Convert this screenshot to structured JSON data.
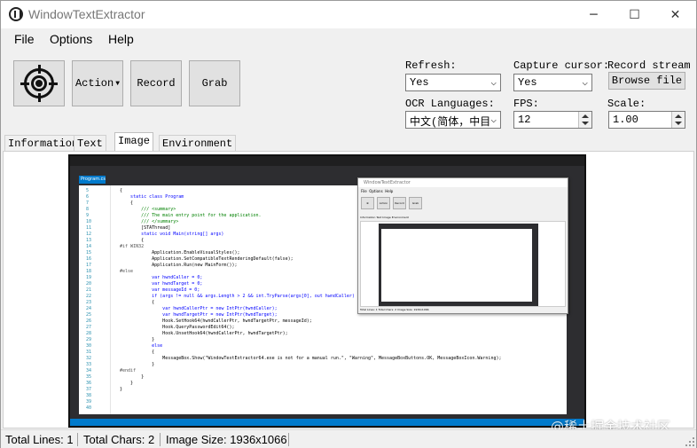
{
  "window": {
    "title": "WindowTextExtractor",
    "minimize": "─",
    "maximize": "☐",
    "close": "✕"
  },
  "menu": {
    "file": "File",
    "options": "Options",
    "help": "Help"
  },
  "toolbar": {
    "action_label": "Action",
    "record_label": "Record",
    "grab_label": "Grab"
  },
  "settings": {
    "refresh_label": "Refresh:",
    "refresh_value": "Yes",
    "capture_cursor_label": "Capture cursor:",
    "capture_cursor_value": "Yes",
    "record_stream_label": "Record stream to:",
    "browse_label": "Browse file",
    "ocr_label": "OCR Languages:",
    "ocr_value": "中文(简体，中目",
    "fps_label": "FPS:",
    "fps_value": "12",
    "scale_label": "Scale:",
    "scale_value": "1.00"
  },
  "tabs": [
    "Information",
    "Text",
    "Image",
    "Environment"
  ],
  "active_tab": "Image",
  "status": {
    "total_lines": "Total Lines: 1",
    "total_chars": "Total Chars: 2",
    "image_size": "Image Size: 1936x1066"
  },
  "watermark": "@稀土掘金技术社区",
  "screenshot": {
    "editor_tab": "Program.cs",
    "nested_title": "WindowTextExtractor",
    "nested_status": "Total Lines: 1   Total Chars: 2   Image Size: 1936x1066",
    "line_numbers": [
      "5",
      "6",
      "7",
      "8",
      "9",
      "10",
      "11",
      "12",
      "13",
      "14",
      "15",
      "16",
      "17",
      "18",
      "19",
      "20",
      "21",
      "22",
      "23",
      "24",
      "25",
      "26",
      "27",
      "28",
      "29",
      "30",
      "31",
      "32",
      "33",
      "34",
      "35",
      "36",
      "37",
      "38",
      "39",
      "40"
    ],
    "code": [
      "  {",
      "      static class Program",
      "      {",
      "          /// <summary>",
      "          /// The main entry point for the application.",
      "          /// </summary>",
      "          [STAThread]",
      "          static void Main(string[] args)",
      "          {",
      "  #if WIN32",
      "              Application.EnableVisualStyles();",
      "              Application.SetCompatibleTextRenderingDefault(false);",
      "              Application.Run(new MainForm());",
      "  #else",
      "              var hwndCaller = 0;",
      "              var hwndTarget = 0;",
      "              var messageId = 0;",
      "              if (args != null && args.Length > 2 && int.TryParse(args[0], out hwndCaller) &&",
      "              {",
      "                  var hwndCallerPtr = new IntPtr(hwndCaller);",
      "                  var hwndTargetPtr = new IntPtr(hwndTarget);",
      "                  Hook.SetHook64(hwndCallerPtr, hwndTargetPtr, messageId);",
      "                  Hook.QueryPasswordEdit64();",
      "                  Hook.UnsetHook64(hwndCallerPtr, hwndTargetPtr);",
      "              }",
      "              else",
      "              {",
      "                  MessageBox.Show(\"WindowTextExtractor64.exe is not for a manual run.\", \"Warning\", MessageBoxButtons.OK, MessageBoxIcon.Warning);",
      "              }",
      "  #endif",
      "          }",
      "      }",
      "  }"
    ]
  }
}
